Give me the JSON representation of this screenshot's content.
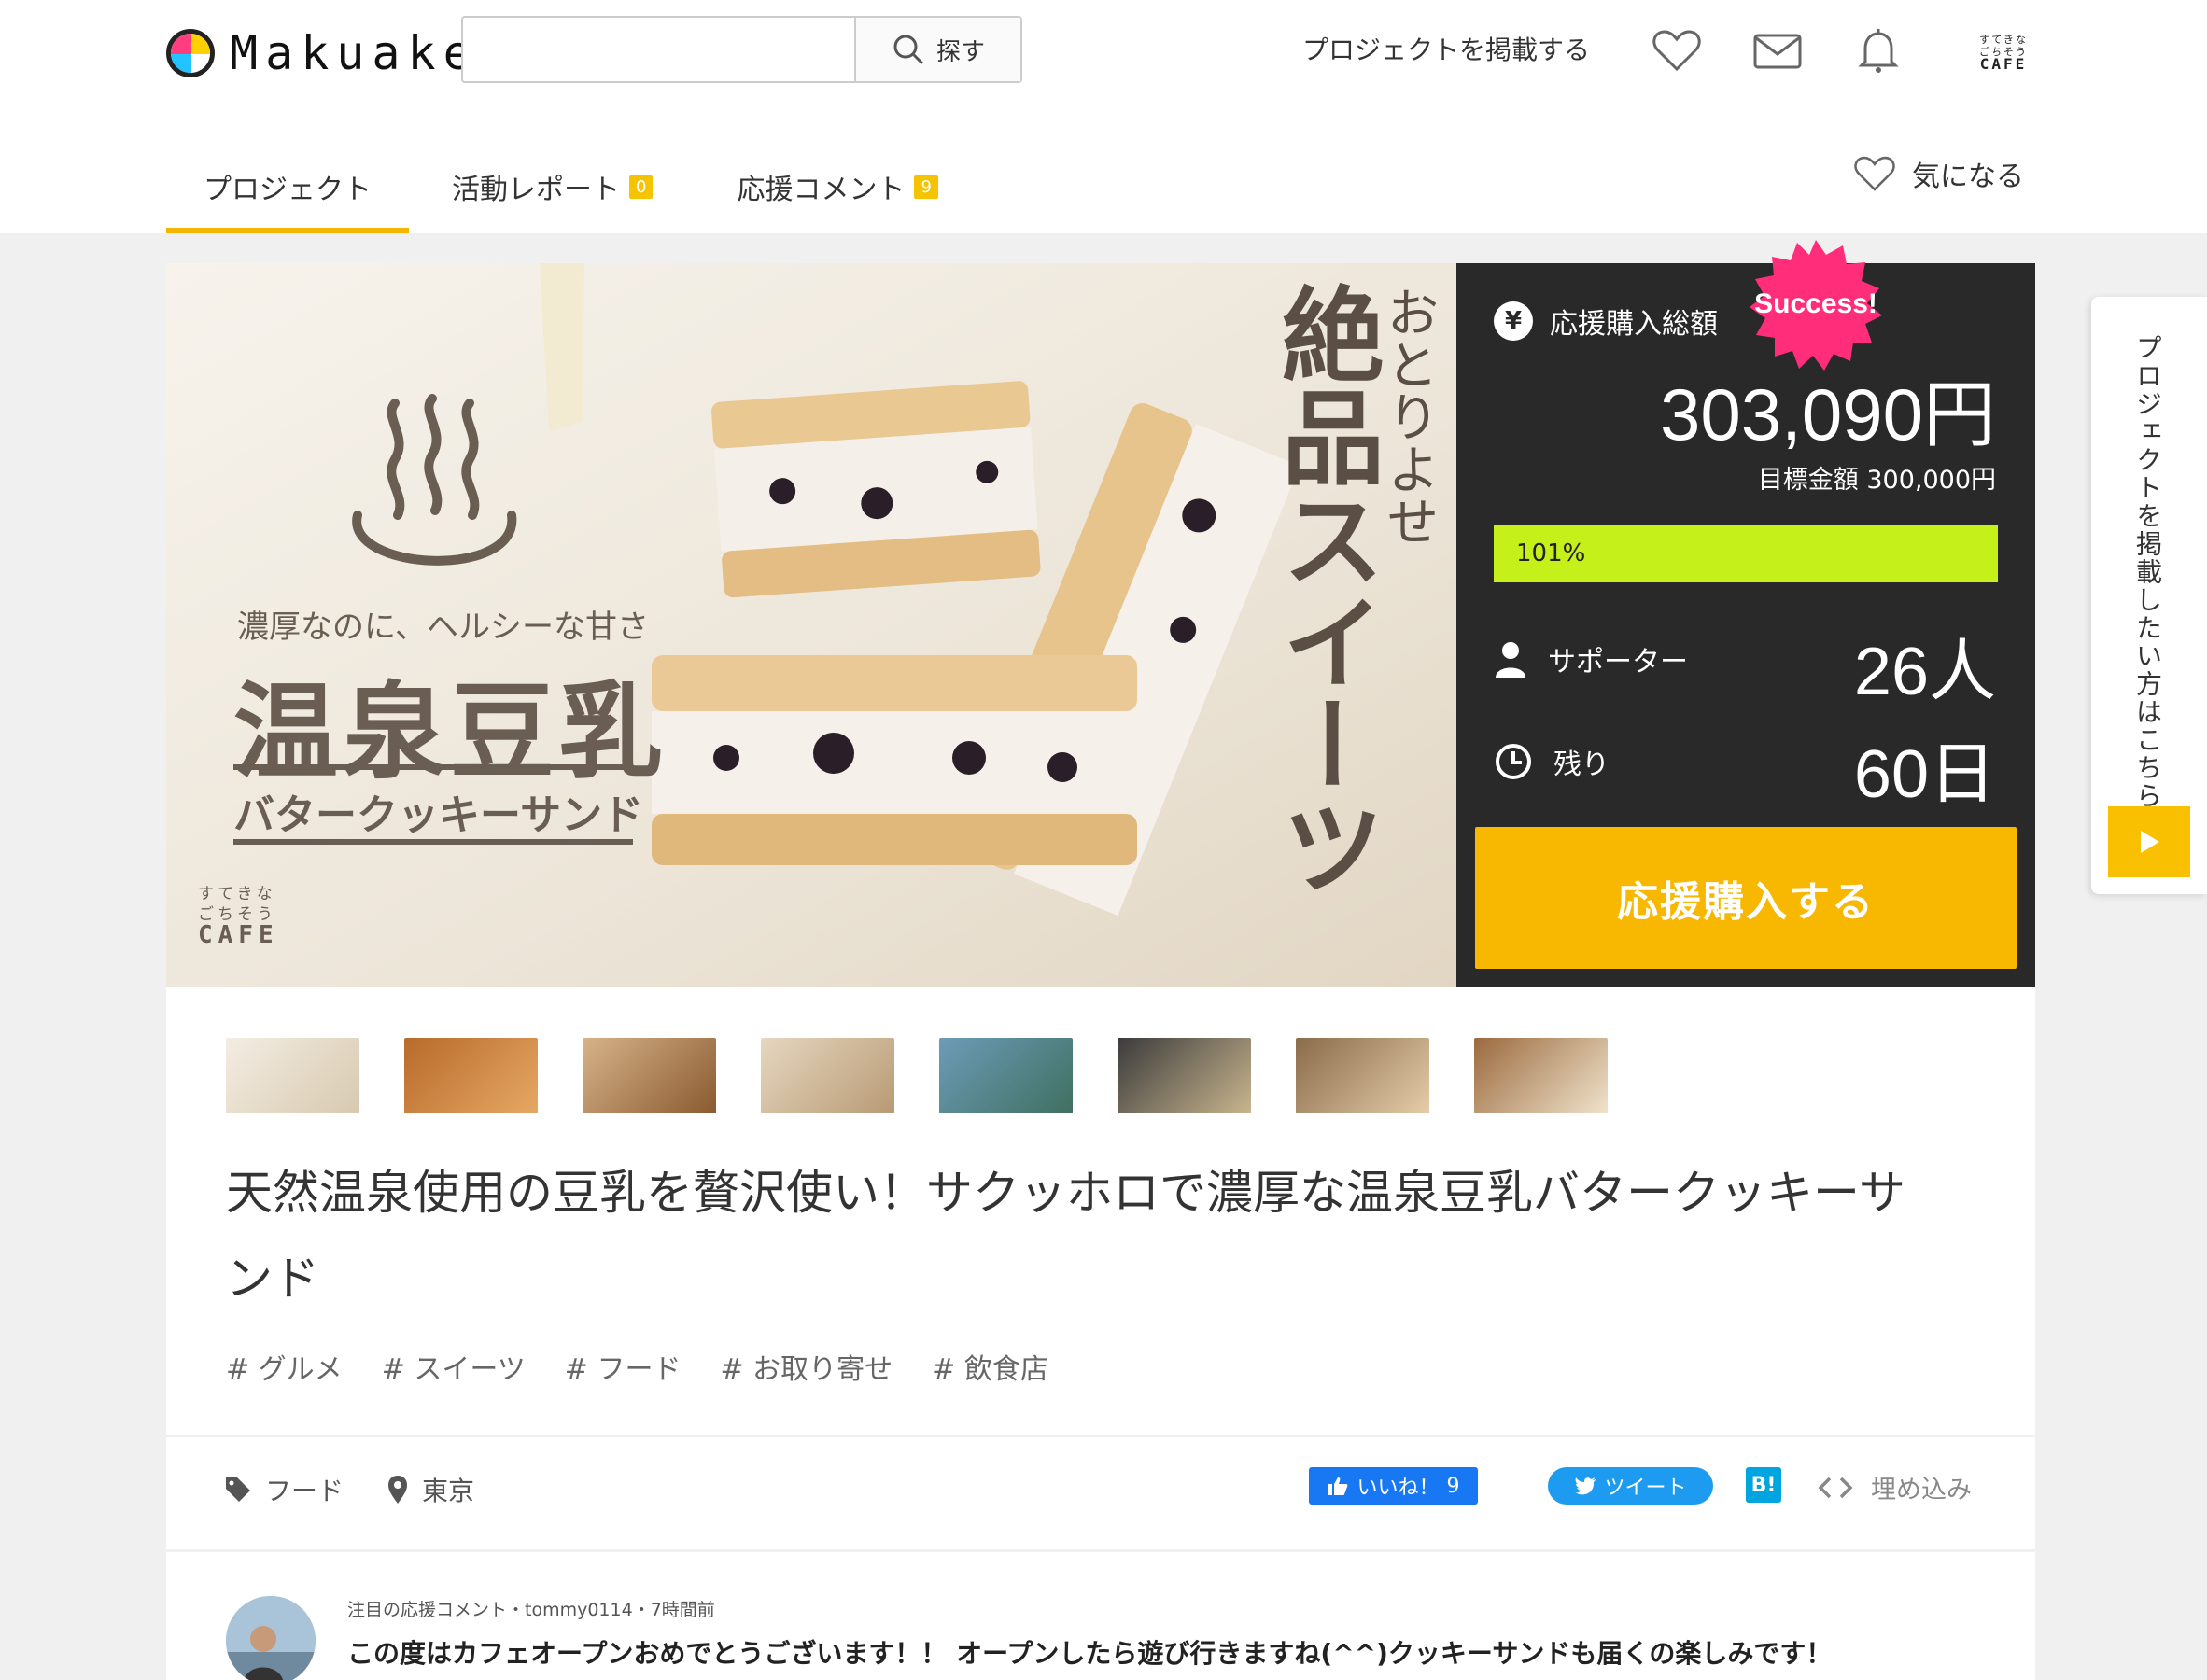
{
  "header": {
    "logo_text": "Makuake",
    "search_placeholder": "",
    "search_label": "探す",
    "post_project": "プロジェクトを掲載する",
    "cafe_logo": {
      "line1": "すてきな",
      "line2": "ごちそう",
      "line3": "CAFE"
    }
  },
  "tabs": [
    {
      "label": "プロジェクト",
      "badge": ""
    },
    {
      "label": "活動レポート",
      "badge": "0"
    },
    {
      "label": "応援コメント",
      "badge": "9"
    }
  ],
  "favorite_label": "気になる",
  "hero": {
    "subtitle": "濃厚なのに、ヘルシーな甘さ",
    "title": "温泉豆乳",
    "product": "バタークッキーサンド",
    "side_title_small": "おとりよせ",
    "side_title_big": "絶品スイーツ",
    "brand": {
      "line1": "すてきな",
      "line2": "ごちそう",
      "line3": "CAFE"
    }
  },
  "panel": {
    "total_label": "応援購入総額",
    "amount": "303,090円",
    "goal": "目標金額 300,000円",
    "progress_label": "101%",
    "progress_fraction": 1.0,
    "supporters_label": "サポーター",
    "supporters_value": "26人",
    "remaining_label": "残り",
    "remaining_value": "60日",
    "cta_label": "応援購入する",
    "success_badge": "Success!"
  },
  "thumbnails": [
    "thumb-1",
    "thumb-2",
    "thumb-3",
    "thumb-4",
    "thumb-5",
    "thumb-6",
    "thumb-7",
    "thumb-8"
  ],
  "project_title": "天然温泉使用の豆乳を贅沢使い！サクッホロで濃厚な温泉豆乳バタークッキーサンド",
  "tags": [
    "# グルメ",
    "# スイーツ",
    "# フード",
    "# お取り寄せ",
    "# 飲食店"
  ],
  "meta": {
    "category": "フード",
    "location": "東京"
  },
  "share": {
    "facebook_label": "いいね！",
    "facebook_count": "9",
    "tweet_label": "ツイート",
    "hatena_label": "B!",
    "embed_label": "埋め込み"
  },
  "comment": {
    "meta": "注目の応援コメント・tommy0114・7時間前",
    "text": "この度はカフェオープンおめでとうございます！！ オープンしたら遊び行きますね(^^)クッキーサンドも届くの楽しみです！"
  },
  "sidetab_label": "プロジェクトを掲載したい方はこちら",
  "colors": {
    "accent": "#f5b400",
    "progress": "#c6f019",
    "cta": "#f8b700",
    "success": "#ff2d7a",
    "panel_bg": "#292929"
  }
}
